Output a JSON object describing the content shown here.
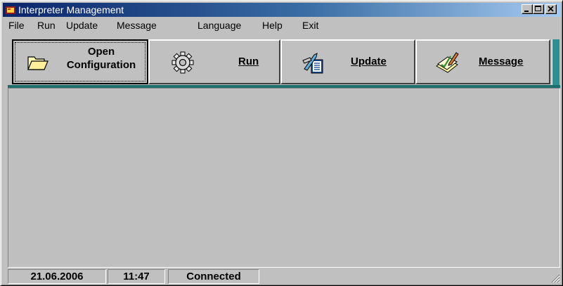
{
  "window": {
    "title": "Interpreter Management"
  },
  "menu": {
    "items": [
      "File",
      "Run",
      "Update",
      "Message",
      "Language",
      "Help",
      "Exit"
    ]
  },
  "toolbar": {
    "open_label_line1": "Open",
    "open_label_line2": "Configuration",
    "run_label": "Run",
    "update_label": "Update",
    "message_label": "Message",
    "accent_color": "#2f8f8f"
  },
  "status": {
    "date": "21.06.2006",
    "time": "11:47",
    "connection": "Connected"
  }
}
